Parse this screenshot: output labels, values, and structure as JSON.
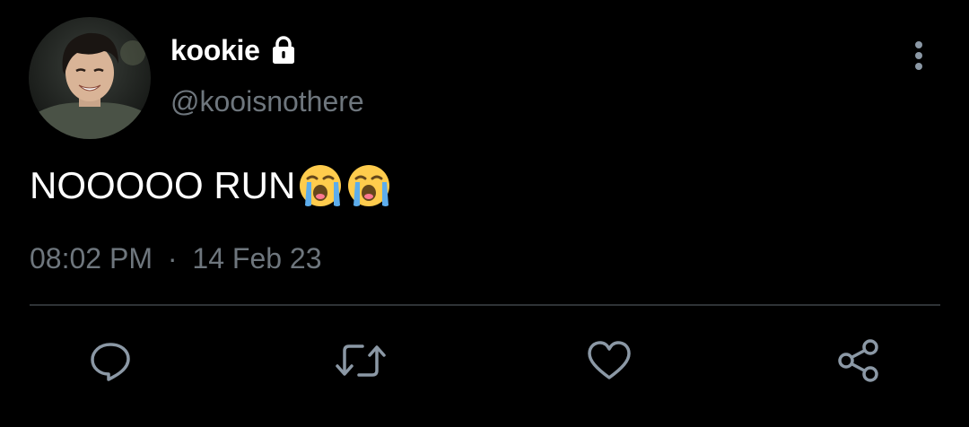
{
  "author": {
    "display_name": "kookie",
    "handle": "@kooisnothere",
    "protected": true,
    "avatar_icon": "profile-photo"
  },
  "tweet": {
    "text": "NOOOOO RUN",
    "emojis": [
      "loudly-crying-face",
      "loudly-crying-face"
    ],
    "time": "08:02 PM",
    "separator": "·",
    "date": "14 Feb 23"
  },
  "actions": [
    "reply-icon",
    "retweet-icon",
    "like-icon",
    "share-icon"
  ],
  "colors": {
    "background": "#000000",
    "primary_text": "#ffffff",
    "secondary_text": "#6e767d",
    "divider": "#2f3336",
    "icon": "#8b98a5"
  }
}
